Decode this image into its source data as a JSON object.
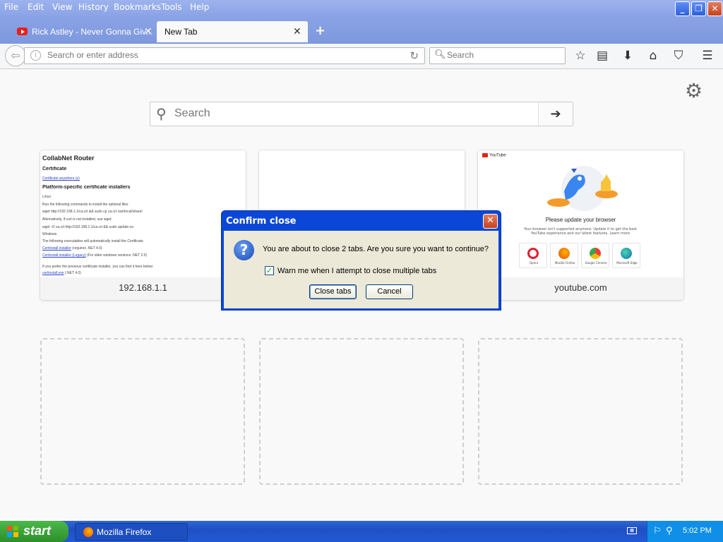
{
  "menu": {
    "file": "File",
    "edit": "Edit",
    "view": "View",
    "history": "History",
    "bookmarks": "Bookmarks",
    "tools": "Tools",
    "help": "Help"
  },
  "tabs": [
    {
      "label": "Rick Astley - Never Gonna Giv...",
      "icon": "youtube-icon"
    },
    {
      "label": "New Tab",
      "active": true
    }
  ],
  "navbar": {
    "address_placeholder": "Search or enter address",
    "search_placeholder": "Search"
  },
  "newtab": {
    "search_placeholder": "Search",
    "tiles": [
      {
        "label": "192.168.1.1",
        "preview": {
          "title": "CollabNet Router",
          "cert_heading": "Certificate",
          "cert_link": "Certificate anywhere (x)",
          "platform_heading": "Platform-specific certificate installers",
          "linux": "Linux",
          "linux_text": "Run the following commands to install the optional files",
          "cmd1": "wget http://192.168.1.1/ca.crt && sudo cp ca.crt /usr/local/share/",
          "alt_text": "Alternatively, if curl is not installed, use wget:",
          "cmd2": "wget -O ca.crt http://192.168.1.1/ca.crt && sudo update-ca",
          "windows": "Windows",
          "windows_text": "The following executables will automatically install the Certificate",
          "link1": "Certinstall installer",
          "link1_note": "(requires .NET 4.0)",
          "link2": "Certinstall installer (Legacy)",
          "link2_note": "(For older windows versions .NET 2.0)",
          "fallback": "If you prefer the previous certificate installer, you can find it here below:",
          "link3": "certinstall.exe",
          "link3_note": "(.NET 4.0)"
        }
      },
      {
        "label": ""
      },
      {
        "label": "youtube.com",
        "preview": {
          "logo": "YouTube",
          "title": "Please update your browser",
          "desc": "Your browser isn't supported anymore. Update it to get the best YouTube experience and our latest features. Learn more",
          "browsers": [
            "Opera",
            "Mozilla Firefox",
            "Google Chrome",
            "Microsoft Edge"
          ]
        }
      }
    ]
  },
  "dialog": {
    "title": "Confirm close",
    "message": "You are about to close 2 tabs. Are you sure you want to continue?",
    "checkbox_label": "Warn me when I attempt to close multiple tabs",
    "checkbox_checked": true,
    "confirm_label": "Close tabs",
    "cancel_label": "Cancel"
  },
  "taskbar": {
    "start_label": "start",
    "window_label": "Mozilla Firefox",
    "clock": "5:02 PM"
  },
  "colors": {
    "titlebar": "#8aa3e6",
    "dialog_frame": "#0a47d6",
    "dialog_body": "#ece9d8",
    "taskbar": "#245ad6",
    "start_button": "#2e8f2c"
  }
}
